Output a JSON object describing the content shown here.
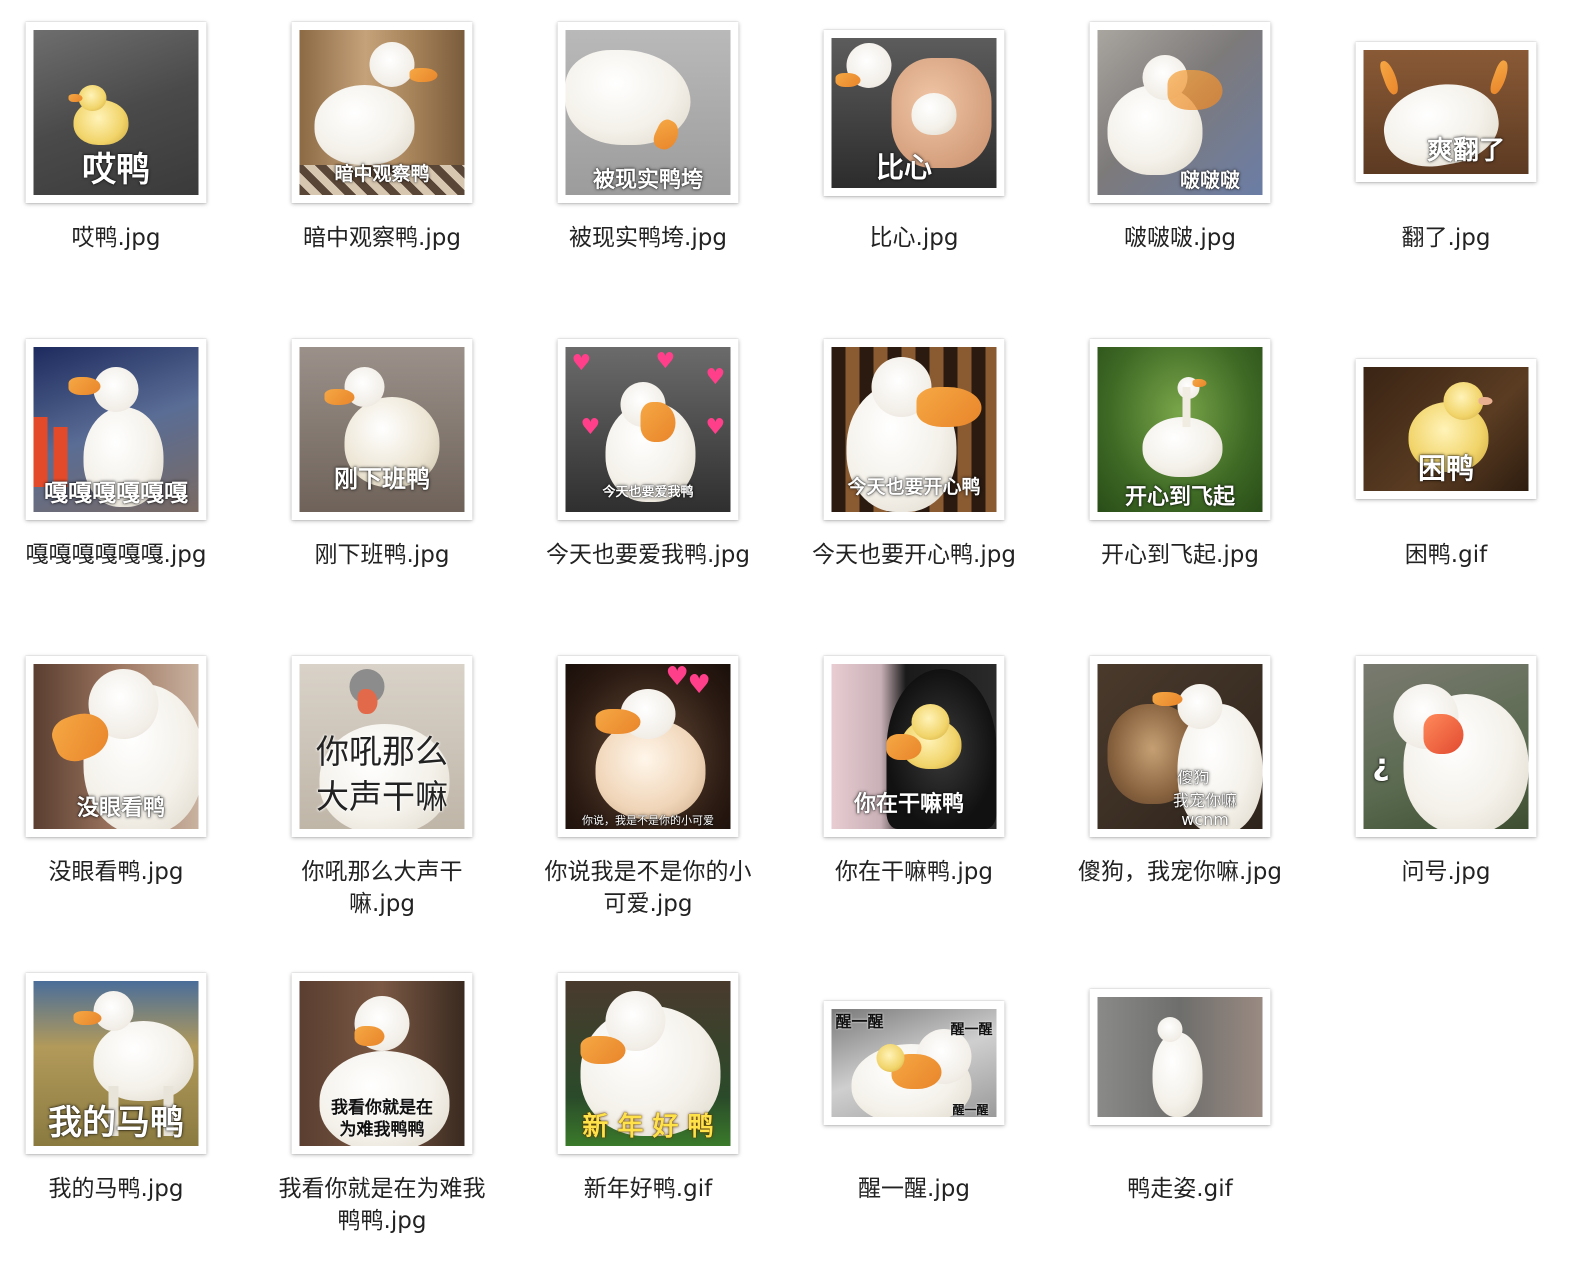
{
  "files": [
    {
      "name": "哎鸭.jpg",
      "caption": "哎鸭"
    },
    {
      "name": "暗中观察鸭.jpg",
      "caption": "暗中观察鸭"
    },
    {
      "name": "被现实鸭垮.jpg",
      "caption": "被现实鸭垮"
    },
    {
      "name": "比心.jpg",
      "caption": "比心"
    },
    {
      "name": "啵啵啵.jpg",
      "caption": "啵啵啵"
    },
    {
      "name": "翻了.jpg",
      "caption": "爽翻了"
    },
    {
      "name": "嘎嘎嘎嘎嘎嘎.jpg",
      "caption": "嘎嘎嘎嘎嘎嘎"
    },
    {
      "name": "刚下班鸭.jpg",
      "caption": "刚下班鸭"
    },
    {
      "name": "今天也要爱我鸭.jpg",
      "caption": "今天也要爱我鸭"
    },
    {
      "name": "今天也要开心鸭.jpg",
      "caption": "今天也要开心鸭"
    },
    {
      "name": "开心到飞起.jpg",
      "caption": "开心到飞起"
    },
    {
      "name": "困鸭.gif",
      "caption": "困鸭"
    },
    {
      "name": "没眼看鸭.jpg",
      "caption": "没眼看鸭"
    },
    {
      "name": "你吼那么大声干嘛.jpg",
      "caption_line1": "你吼那么",
      "caption_line2": "大声干嘛"
    },
    {
      "name": "你说我是不是你的小可爱.jpg",
      "caption": "你说，我是不是你的小可爱"
    },
    {
      "name": "你在干嘛鸭.jpg",
      "caption": "你在干嘛鸭"
    },
    {
      "name": "傻狗，我宠你嘛.jpg",
      "caption_line1": "傻狗",
      "caption_line2": "我宠你嘛",
      "caption_line3": "wcnm"
    },
    {
      "name": "问号.jpg",
      "caption": "¿"
    },
    {
      "name": "我的马鸭.jpg",
      "caption": "我的马鸭"
    },
    {
      "name": "我看你就是在为难我鸭鸭.jpg",
      "caption_line1": "我看你就是在",
      "caption_line2": "为难我鸭鸭"
    },
    {
      "name": "新年好鸭.gif",
      "caption": "新 年 好 鸭"
    },
    {
      "name": "醒一醒.jpg",
      "caption": "醒一醒"
    },
    {
      "name": "鸭走姿.gif",
      "caption": ""
    }
  ]
}
